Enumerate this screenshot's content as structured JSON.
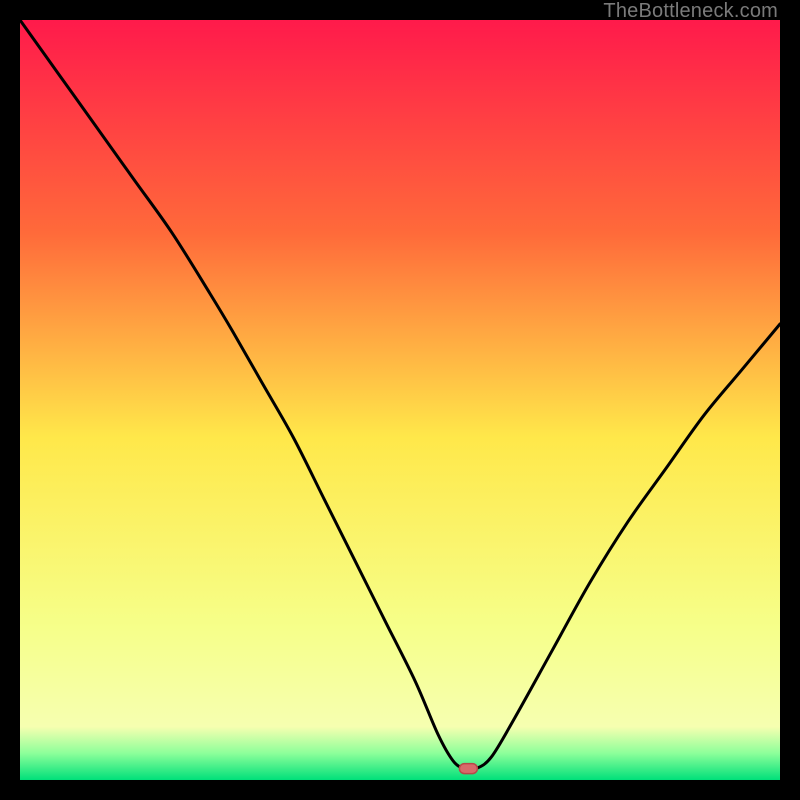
{
  "watermark": "TheBottleneck.com",
  "colors": {
    "frame": "#000000",
    "gradient_top": "#ff1a4b",
    "gradient_mid1": "#ff6a3a",
    "gradient_mid2": "#ffb93a",
    "gradient_mid3": "#ffe84a",
    "gradient_mid4": "#f6ff8a",
    "gradient_bottom1": "#8cff9a",
    "gradient_bottom2": "#00e07a",
    "curve": "#000000",
    "dot_fill": "#d86a6a",
    "dot_stroke": "#b84848"
  },
  "chart_data": {
    "type": "line",
    "title": "",
    "xlabel": "",
    "ylabel": "",
    "xlim": [
      0,
      100
    ],
    "ylim": [
      0,
      100
    ],
    "x": [
      0,
      5,
      10,
      15,
      20,
      25,
      28,
      32,
      36,
      40,
      44,
      48,
      52,
      55,
      57,
      58.5,
      60,
      62,
      65,
      70,
      75,
      80,
      85,
      90,
      95,
      100
    ],
    "values": [
      100,
      93,
      86,
      79,
      72,
      64,
      59,
      52,
      45,
      37,
      29,
      21,
      13,
      6,
      2.5,
      1.5,
      1.5,
      3,
      8,
      17,
      26,
      34,
      41,
      48,
      54,
      60
    ],
    "dot": {
      "x": 59,
      "y": 1.5
    },
    "legend": [],
    "grid": false
  }
}
